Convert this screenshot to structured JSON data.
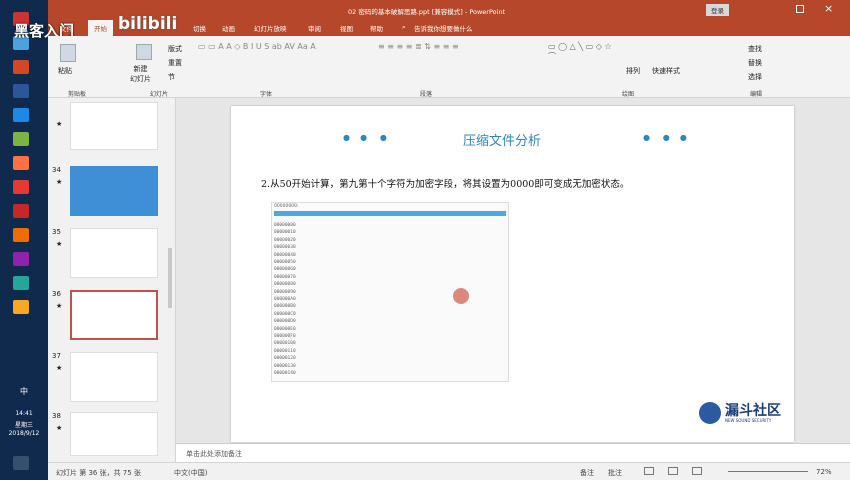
{
  "window": {
    "title": "02 密码的基本破解思路.ppt [兼容模式] - PowerPoint",
    "signin": "登录",
    "restore_icon": "restore-icon",
    "close_icon": "close-icon"
  },
  "overlay": {
    "top_logo": "黑客入门",
    "bilibili": "bilibili",
    "watermark": "漏斗社区",
    "watermark_sub": "NEW SOUND SECURITY"
  },
  "tabs": [
    "文件",
    "开始",
    "切换",
    "动画",
    "幻灯片放映",
    "审阅",
    "视图",
    "帮助",
    "告诉我你想要做什么"
  ],
  "ribbon": {
    "paste": "粘贴",
    "clipboard": "剪贴板",
    "new_slide": "新建\n幻灯片",
    "slides": "幻灯片",
    "layout": "版式",
    "reset": "重置",
    "section": "节",
    "font": "字体",
    "paragraph": "段落",
    "arrange": "排列",
    "quick_styles": "快速样式",
    "drawing": "绘图",
    "find": "查找",
    "replace": "替换",
    "select": "选择",
    "editing": "编辑"
  },
  "thumbnails": [
    {
      "num": "",
      "star": "★"
    },
    {
      "num": "34",
      "star": "★"
    },
    {
      "num": "35",
      "star": "★"
    },
    {
      "num": "36",
      "star": "★"
    },
    {
      "num": "37",
      "star": "★"
    },
    {
      "num": "38",
      "star": "★"
    }
  ],
  "slide": {
    "title": "压缩文件分析",
    "text": "2.从50开始计算，第九第十个字符为加密字段，将其设置为0000即可变成无加密状态。",
    "hex_header": "00000000:",
    "hex_rows": [
      "00000000",
      "00000010",
      "00000020",
      "00000030",
      "00000040",
      "00000050",
      "00000060",
      "00000070",
      "00000080",
      "00000090",
      "000000A0",
      "000000B0",
      "000000C0",
      "000000D0",
      "000000E0",
      "000000F0",
      "00000100",
      "00000110",
      "00000120",
      "00000130",
      "00000140"
    ]
  },
  "notes": {
    "placeholder": "单击此处添加备注"
  },
  "status": {
    "slide_info": "幻灯片 第 36 张，共 75 张",
    "lang": "中文(中国)",
    "notes_btn": "备注",
    "comments_btn": "批注",
    "zoom": "72%"
  },
  "clock": {
    "time": "14:41",
    "weekday": "星期三",
    "date": "2018/9/12",
    "ime": "中"
  }
}
